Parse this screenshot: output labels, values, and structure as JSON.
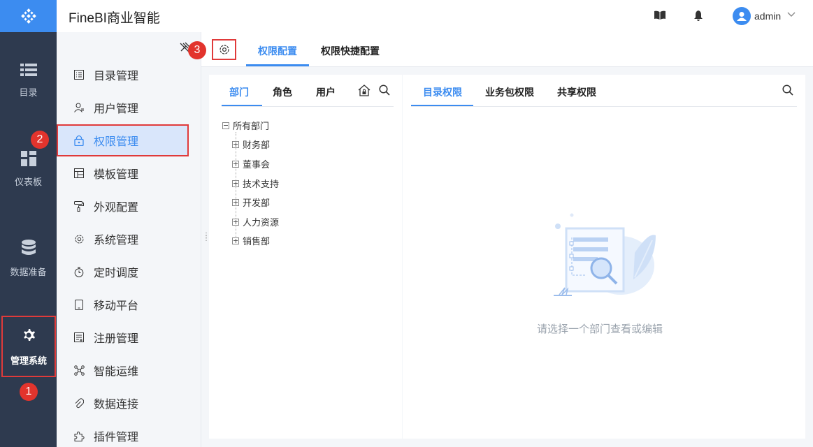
{
  "app": {
    "title": "FineBI商业智能",
    "user": "admin"
  },
  "rail": {
    "items": [
      {
        "label": "目录",
        "icon": "catalog-icon"
      },
      {
        "label": "仪表板",
        "icon": "dashboard-icon"
      },
      {
        "label": "数据准备",
        "icon": "database-icon"
      },
      {
        "label": "管理系统",
        "icon": "gear-icon",
        "active": true
      }
    ]
  },
  "badges": {
    "b1": "1",
    "b2": "2",
    "b3": "3"
  },
  "subnav": {
    "items": [
      {
        "label": "目录管理",
        "icon": "catalog-manage-icon"
      },
      {
        "label": "用户管理",
        "icon": "user-icon"
      },
      {
        "label": "权限管理",
        "icon": "lock-icon",
        "active": true
      },
      {
        "label": "模板管理",
        "icon": "template-icon"
      },
      {
        "label": "外观配置",
        "icon": "paint-roller-icon"
      },
      {
        "label": "系统管理",
        "icon": "gear-icon"
      },
      {
        "label": "定时调度",
        "icon": "timer-icon"
      },
      {
        "label": "移动平台",
        "icon": "mobile-icon"
      },
      {
        "label": "注册管理",
        "icon": "register-icon"
      },
      {
        "label": "智能运维",
        "icon": "ops-icon"
      },
      {
        "label": "数据连接",
        "icon": "link-icon"
      },
      {
        "label": "插件管理",
        "icon": "plugin-icon"
      }
    ]
  },
  "top_tabs": [
    {
      "label": "权限配置",
      "active": true
    },
    {
      "label": "权限快捷配置"
    }
  ],
  "left_tabs": [
    {
      "label": "部门",
      "active": true
    },
    {
      "label": "角色"
    },
    {
      "label": "用户"
    }
  ],
  "right_tabs": [
    {
      "label": "目录权限",
      "active": true
    },
    {
      "label": "业务包权限"
    },
    {
      "label": "共享权限"
    }
  ],
  "tree": {
    "root": "所有部门",
    "children": [
      "财务部",
      "董事会",
      "技术支持",
      "开发部",
      "人力资源",
      "销售部"
    ]
  },
  "empty_state": {
    "message": "请选择一个部门查看或编辑"
  },
  "colors": {
    "accent": "#3c8cf0",
    "highlight": "#e03a3a",
    "rail": "#2e3a4f"
  }
}
